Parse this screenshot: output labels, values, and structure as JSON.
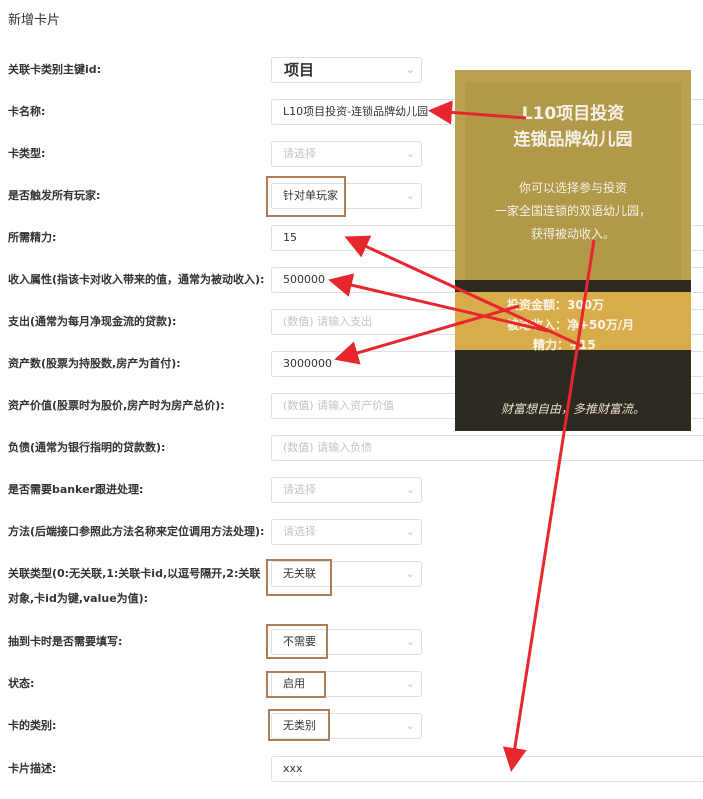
{
  "page": {
    "title": "新增卡片"
  },
  "form": {
    "fields": [
      {
        "label": "关联卡类别主键id:",
        "value": "项目"
      },
      {
        "label": "卡名称:",
        "value": "L10项目投资-连锁品牌幼儿园"
      },
      {
        "label": "卡类型:",
        "placeholder": "请选择"
      },
      {
        "label": "是否触发所有玩家:",
        "value": "针对单玩家"
      },
      {
        "label": "所需精力:",
        "value": "15"
      },
      {
        "label": "收入属性(指该卡对收入带来的值，通常为被动收入):",
        "value": "500000"
      },
      {
        "label": "支出(通常为每月净现金流的贷款):",
        "placeholder": "(数值) 请输入支出"
      },
      {
        "label": "资产数(股票为持股数,房产为首付):",
        "value": "3000000"
      },
      {
        "label": "资产价值(股票时为股价,房产时为房产总价):",
        "placeholder": "(数值) 请输入资产价值"
      },
      {
        "label": "负债(通常为银行指明的贷款数):",
        "placeholder": "(数值) 请输入负债"
      },
      {
        "label": "是否需要banker跟进处理:",
        "placeholder": "请选择"
      },
      {
        "label": "方法(后端接口参照此方法名称来定位调用方法处理):",
        "placeholder": "请选择"
      },
      {
        "label": "关联类型(0:无关联,1:关联卡id,以逗号隔开,2:关联对象,卡id为键,value为值):",
        "value": "无关联"
      },
      {
        "label": "抽到卡时是否需要填写:",
        "value": "不需要"
      },
      {
        "label": "状态:",
        "value": "启用"
      },
      {
        "label": "卡的类别:",
        "value": "无类别"
      },
      {
        "label": "卡片描述:",
        "value": "xxx"
      }
    ]
  },
  "card_image": {
    "title_line1": "L10项目投资",
    "title_line2": "连锁品牌幼儿园",
    "desc_line1": "你可以选择参与投资",
    "desc_line2": "一家全国连锁的双语幼儿园，",
    "desc_line3": "获得被动收入。",
    "stat1": "投资金额：300万",
    "stat2": "被动收入：净+50万/月",
    "stat3": "精力：+15",
    "footer": "财富想自由，多推财富流。"
  },
  "colors": {
    "arrow": "#e8262d",
    "highlight_box": "#b07d5b",
    "border": "#dcdfe6",
    "placeholder": "#c0c4cc"
  },
  "icons": {
    "select_chevron": "chevron-down-icon"
  }
}
